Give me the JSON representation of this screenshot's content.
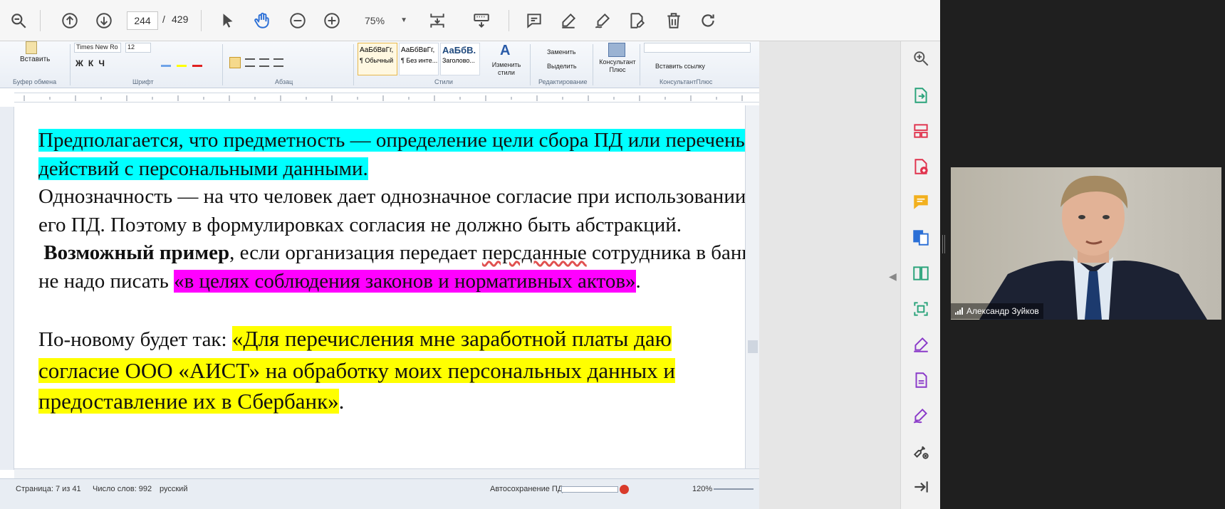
{
  "toolbar": {
    "current_page": "244",
    "page_separator": "/",
    "total_pages": "429",
    "zoom": "75%"
  },
  "word": {
    "ribbon": {
      "paste_label": "Вставить",
      "font_name": "Times New Ro",
      "font_size": "12",
      "style_tiles": [
        {
          "preview": "АаБбВвГг,",
          "name": "¶ Обычный"
        },
        {
          "preview": "АаБбВвГг,",
          "name": "¶ Без инте..."
        },
        {
          "preview": "АаБбВ.",
          "name": "Заголово..."
        }
      ],
      "change_styles": "Изменить стили",
      "replace": "Заменить",
      "select": "Выделить",
      "consultant": "Консультант Плюс",
      "insert_link": "Вставить ссылку",
      "groups": {
        "clipboard": "Буфер обмена",
        "font": "Шрифт",
        "paragraph": "Абзац",
        "styles": "Стили",
        "editing": "Редактирование",
        "consultant": "КонсультантПлюс"
      }
    },
    "document": {
      "p1": "Предполагается, что предметность — определение цели сбора ПД или перечень действий с персональными данными.",
      "p2a": "Однозначность — на что человек дает однозначное согласие при использовании",
      "p2b": "его ПД. Поэтому в формулировках согласия не должно быть абстракций.",
      "p3_bold": "Возможный пример",
      "p3_a": ", если организация передает ",
      "p3_spell": "перcданные",
      "p3_b": " сотрудника в банк,",
      "p4_a": "не надо писать ",
      "p4_hl": "«в целях соблюдения законов и нормативных актов»",
      "p4_b": ".",
      "p5_a": "По-новому будет так: ",
      "p5_hl1": "«Для перечисления мне заработной платы даю",
      "p5_hl2": "согласие ООО «АИСТ» на обработку моих персональных данных и",
      "p5_hl3": "предоставление их в Сбербанк»",
      "p5_end": "."
    },
    "status": {
      "page": "Страница: 7 из 41",
      "words": "Число слов: 992",
      "language": "русский",
      "autosave": "Автосохранение ПД",
      "zoom": "120%"
    }
  },
  "video": {
    "participant_name": "Александр Зуйков"
  },
  "colors": {
    "highlight_cyan": "#00ffff",
    "highlight_magenta": "#ff00ff",
    "highlight_yellow": "#ffff00",
    "rail_red": "#e0334d",
    "rail_green": "#29a37a",
    "rail_purple": "#8a3ac9",
    "rail_yellow": "#f2b01e"
  }
}
